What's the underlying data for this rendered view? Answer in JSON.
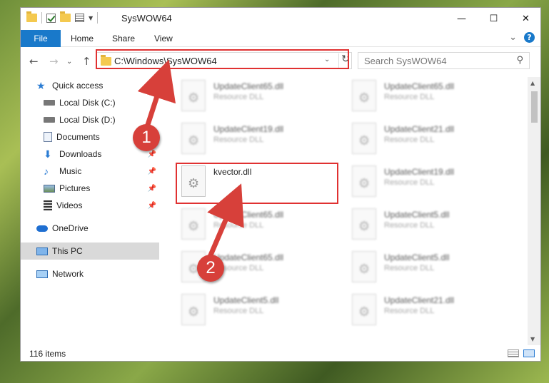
{
  "window": {
    "title": "SysWOW64",
    "minimize_glyph": "—",
    "maximize_glyph": "☐",
    "close_glyph": "✕"
  },
  "ribbon": {
    "tabs": [
      "File",
      "Home",
      "Share",
      "View"
    ],
    "expand_glyph": "⌄",
    "help_glyph": "?"
  },
  "nav": {
    "back_glyph": "←",
    "forward_glyph": "→",
    "recent_glyph": "⌄",
    "up_glyph": "↑",
    "address": "C:\\Windows\\SysWOW64",
    "address_dropdown_glyph": "⌄",
    "refresh_glyph": "↻",
    "search_placeholder": "Search SysWOW64",
    "search_glyph": "⚲"
  },
  "sidebar": {
    "items": [
      {
        "label": "Quick access",
        "icon": "star-icon",
        "pinned": false
      },
      {
        "label": "Local Disk (C:)",
        "icon": "drive-icon",
        "pinned": false
      },
      {
        "label": "Local Disk (D:)",
        "icon": "drive-icon",
        "pinned": false
      },
      {
        "label": "Documents",
        "icon": "documents-icon",
        "pinned": false
      },
      {
        "label": "Downloads",
        "icon": "download-icon",
        "pinned": true
      },
      {
        "label": "Music",
        "icon": "music-icon",
        "pinned": true
      },
      {
        "label": "Pictures",
        "icon": "pictures-icon",
        "pinned": true
      },
      {
        "label": "Videos",
        "icon": "videos-icon",
        "pinned": true
      },
      {
        "label": "OneDrive",
        "icon": "cloud-icon",
        "pinned": false
      },
      {
        "label": "This PC",
        "icon": "computer-icon",
        "pinned": false,
        "selected": true
      },
      {
        "label": "Network",
        "icon": "network-icon",
        "pinned": false
      }
    ],
    "pin_glyph": "📌"
  },
  "files": {
    "left": [
      {
        "name": "UpdateClient65.dll",
        "type": "Resource DLL"
      },
      {
        "name": "UpdateClient19.dll",
        "type": "Resource DLL"
      },
      {
        "name": "kvector.dll",
        "type": ""
      },
      {
        "name": "UpdateClient65.dll",
        "type": "Resource DLL"
      },
      {
        "name": "UpdateClient65.dll",
        "type": "Resource DLL"
      },
      {
        "name": "UpdateClient5.dll",
        "type": "Resource DLL"
      }
    ],
    "right": [
      {
        "name": "UpdateClient65.dll",
        "type": "Resource DLL"
      },
      {
        "name": "UpdateClient21.dll",
        "type": "Resource DLL"
      },
      {
        "name": "UpdateClient19.dll",
        "type": "Resource DLL"
      },
      {
        "name": "UpdateClient5.dll",
        "type": "Resource DLL"
      },
      {
        "name": "UpdateClient5.dll",
        "type": "Resource DLL"
      },
      {
        "name": "UpdateClient21.dll",
        "type": "Resource DLL"
      }
    ]
  },
  "status": {
    "item_count": "116 items"
  },
  "callouts": [
    "1",
    "2"
  ],
  "colors": {
    "accent": "#1979ca",
    "highlight": "#e03131",
    "callout": "#d7403a",
    "selected": "#d9d9d9"
  }
}
